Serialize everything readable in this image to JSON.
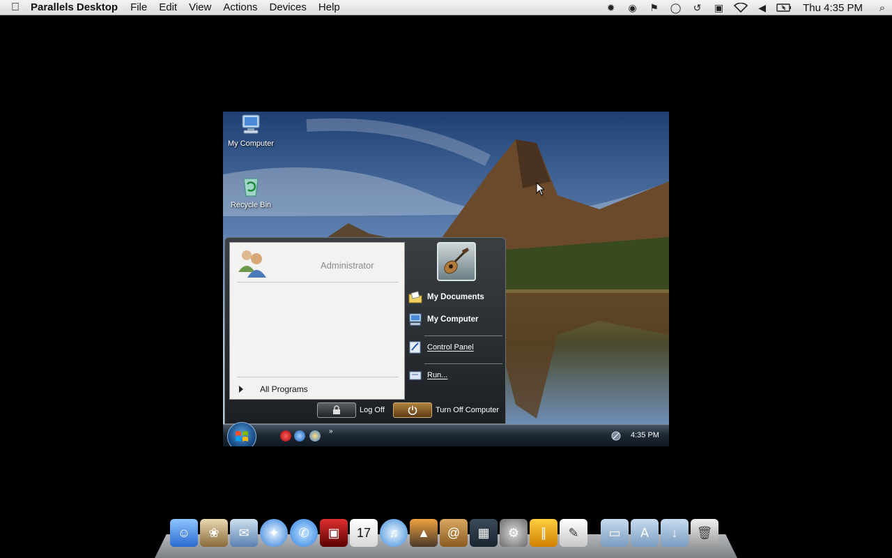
{
  "menubar": {
    "app_name": "Parallels Desktop",
    "menus": [
      "File",
      "Edit",
      "View",
      "Actions",
      "Devices",
      "Help"
    ],
    "clock": "Thu 4:35 PM",
    "status_icons": [
      "gear-icon",
      "parallels-icon",
      "flag-icon",
      "chat-icon",
      "time-machine-icon",
      "grid-icon",
      "wifi-icon",
      "volume-icon",
      "battery-icon"
    ]
  },
  "desktop": {
    "icons": [
      {
        "label": "My Computer",
        "icon": "computer-icon"
      },
      {
        "label": "Recycle Bin",
        "icon": "recycle-bin-icon"
      }
    ]
  },
  "start_menu": {
    "user_name": "Administrator",
    "all_programs": "All Programs",
    "right_items": [
      {
        "label": "My Documents",
        "icon": "documents-icon",
        "bold": true
      },
      {
        "label": "My Computer",
        "icon": "computer-icon",
        "bold": true
      },
      {
        "label": "Control Panel",
        "icon": "control-panel-icon",
        "bold": false
      },
      {
        "label": "Run...",
        "icon": "run-icon",
        "bold": false
      }
    ],
    "log_off": "Log Off",
    "turn_off": "Turn Off Computer"
  },
  "taskbar": {
    "quicklaunch_more": "»",
    "clock": "4:35 PM"
  },
  "dock": {
    "apps": [
      "finder-icon",
      "preview-icon",
      "mail-icon",
      "safari-icon",
      "ichat-icon",
      "dvd-player-icon",
      "ical-icon",
      "itunes-icon",
      "iphoto-icon",
      "address-book-icon",
      "dashboard-icon",
      "system-preferences-icon",
      "parallels-icon",
      "textedit-icon"
    ],
    "stacks": [
      "documents-folder-icon",
      "applications-folder-icon",
      "downloads-folder-icon",
      "trash-icon"
    ]
  }
}
